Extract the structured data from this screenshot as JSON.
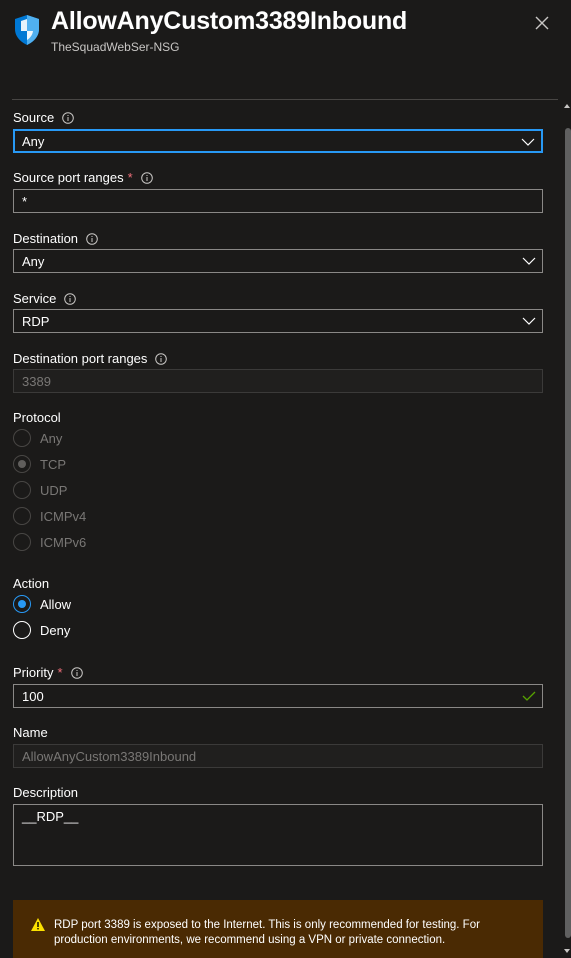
{
  "header": {
    "title": "AllowAnyCustom3389Inbound",
    "subtitle": "TheSquadWebSer-NSG"
  },
  "form": {
    "source": {
      "label": "Source",
      "value": "Any"
    },
    "source_port_ranges": {
      "label": "Source port ranges",
      "required_mark": "*",
      "value": "*"
    },
    "destination": {
      "label": "Destination",
      "value": "Any"
    },
    "service": {
      "label": "Service",
      "value": "RDP"
    },
    "destination_port_ranges": {
      "label": "Destination port ranges",
      "value": "3389"
    },
    "protocol": {
      "label": "Protocol",
      "options": [
        "Any",
        "TCP",
        "UDP",
        "ICMPv4",
        "ICMPv6"
      ],
      "selected": "TCP"
    },
    "action": {
      "label": "Action",
      "options": [
        "Allow",
        "Deny"
      ],
      "selected": "Allow"
    },
    "priority": {
      "label": "Priority",
      "required_mark": "*",
      "value": "100"
    },
    "name": {
      "label": "Name",
      "value": "AllowAnyCustom3389Inbound"
    },
    "description": {
      "label": "Description",
      "value": "__RDP__"
    }
  },
  "warning": {
    "text": "RDP port 3389 is exposed to the Internet. This is only recommended for testing. For production environments, we recommend using a VPN or private connection."
  },
  "colors": {
    "background": "#1b1a19",
    "accent": "#2899f5",
    "required": "#f1707b",
    "success": "#57a300",
    "warning_bg": "#4a2a03",
    "warning_icon": "#fce100"
  },
  "icons": {
    "header": "shield-icon",
    "close": "close-icon",
    "info": "info-icon",
    "dropdown": "chevron-down-icon",
    "valid": "checkmark-icon",
    "warning": "warning-icon"
  }
}
